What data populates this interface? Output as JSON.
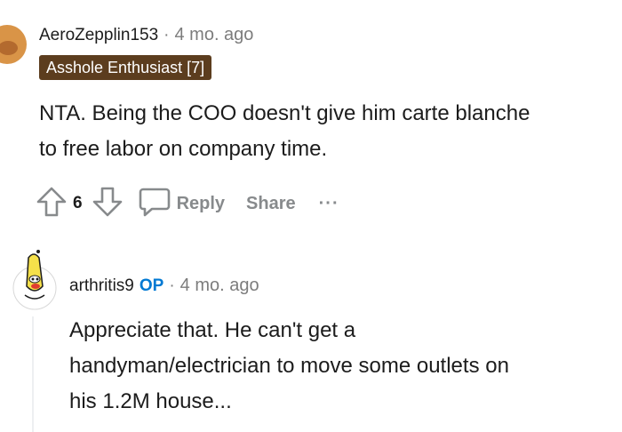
{
  "comment1": {
    "username": "AeroZepplin153",
    "separator": "·",
    "time": "4 mo. ago",
    "flair": "Asshole Enthusiast [7]",
    "body_lines": [
      "NTA. Being the COO doesn't give him carte blanche",
      "to free labor on company time."
    ],
    "votes": "6",
    "actions": {
      "reply": "Reply",
      "share": "Share",
      "more": "···"
    },
    "avatar_color": "#d99447",
    "flair_color": "#5c3d1e"
  },
  "comment2": {
    "username": "arthritis9",
    "op_badge": "OP",
    "separator": "·",
    "time": "4 mo. ago",
    "body_lines": [
      "Appreciate that. He can't get a",
      "handyman/electrician to move some outlets on",
      "his 1.2M house..."
    ],
    "op_color": "#0079d3"
  }
}
